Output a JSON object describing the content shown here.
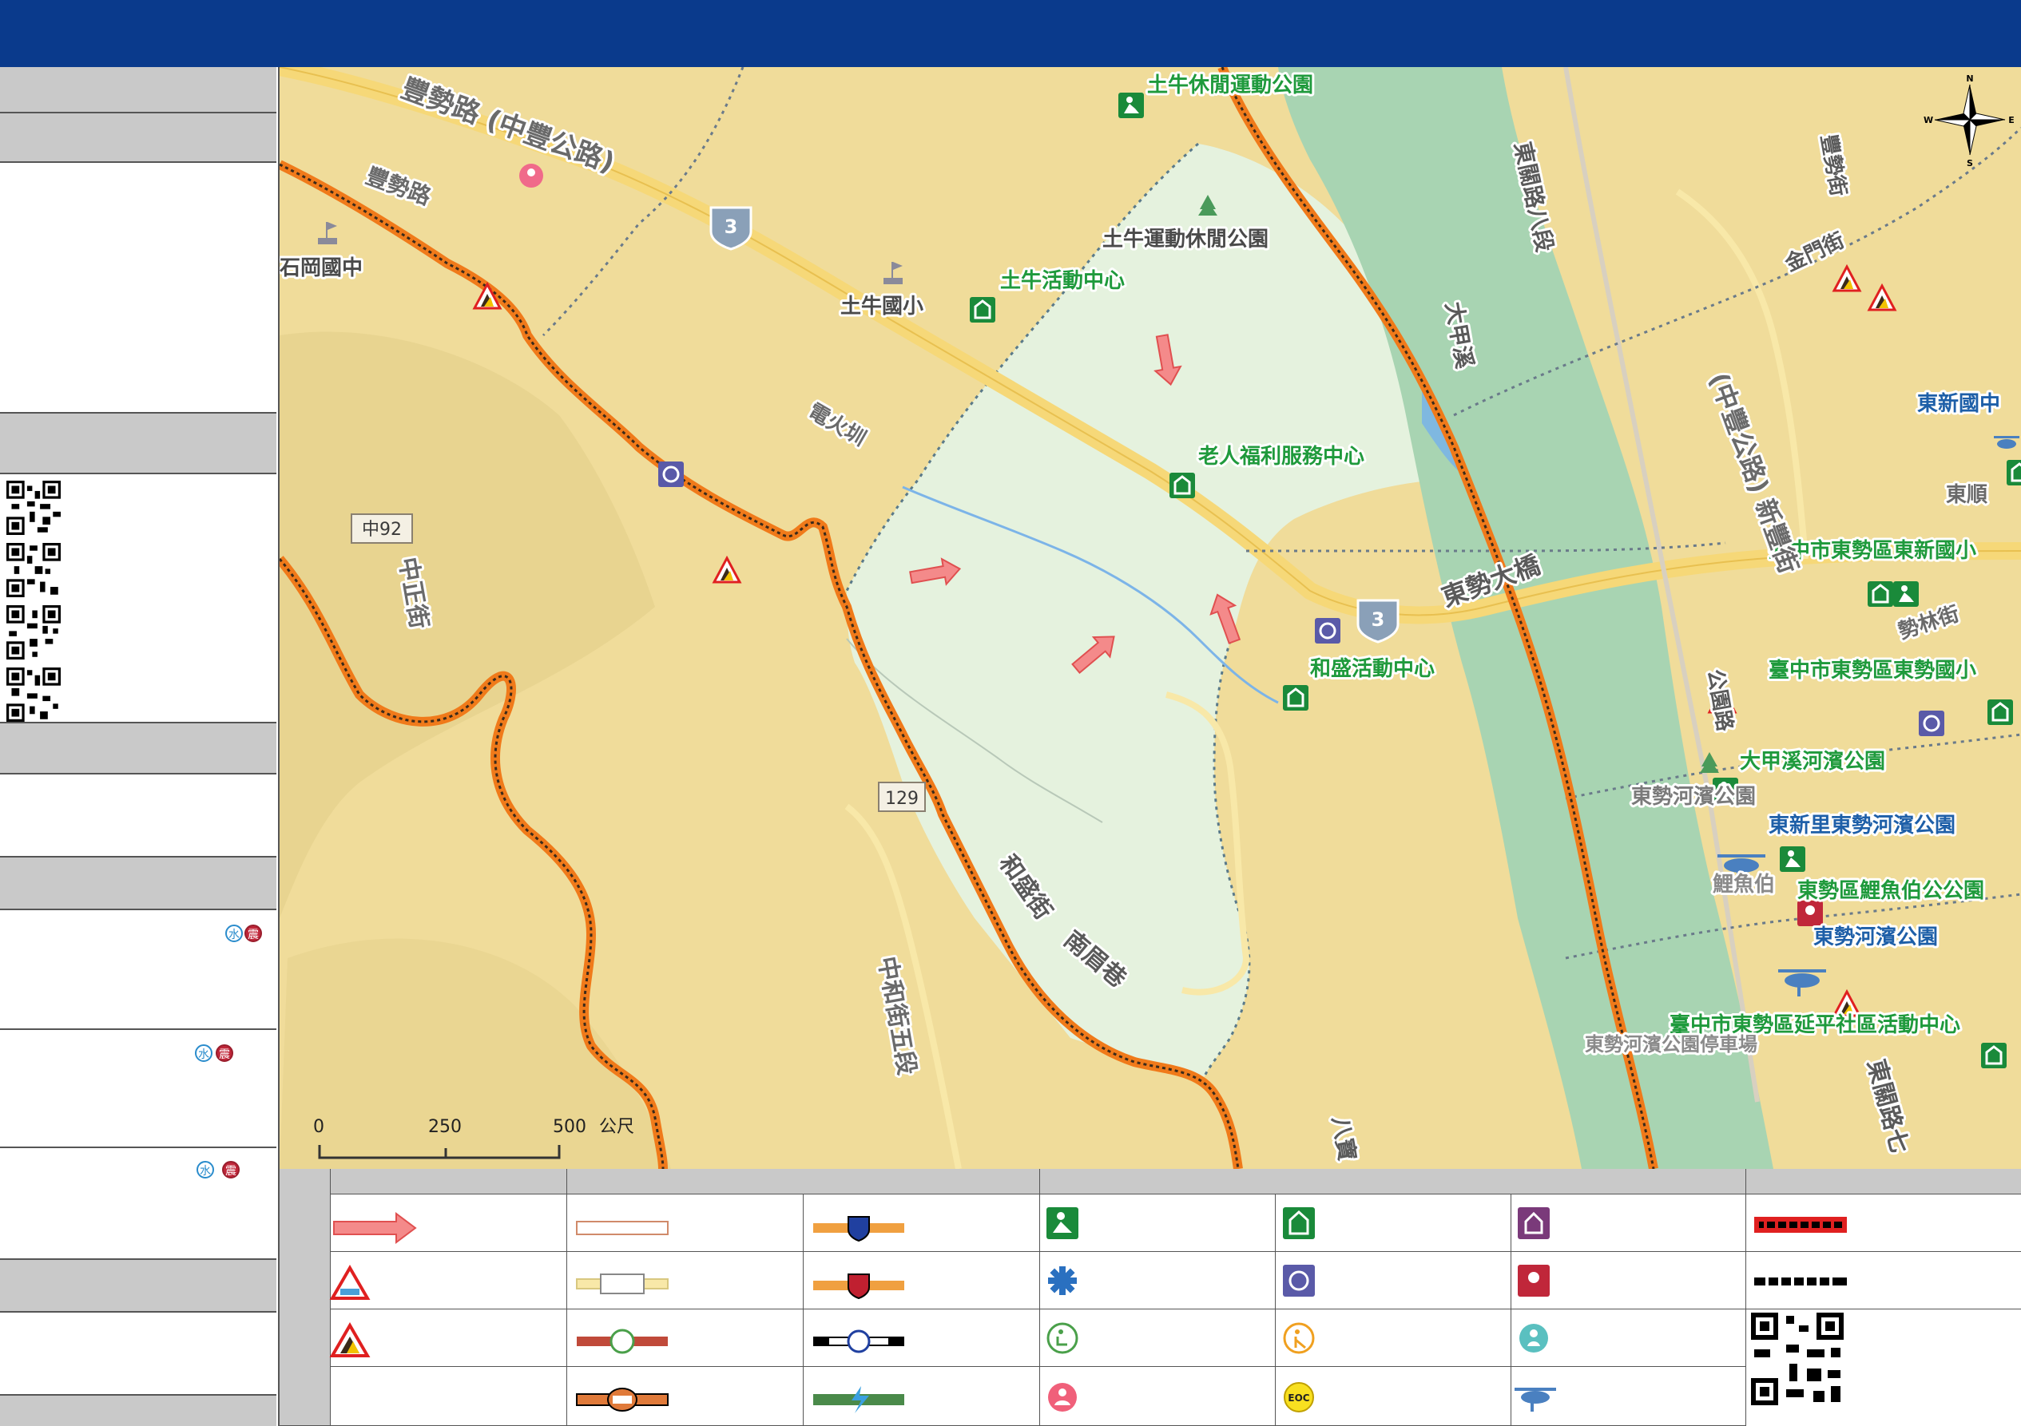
{
  "map": {
    "place_labels": {
      "tuniu_leisure_park": "土牛休閒運動公園",
      "tuniu_sports_park": "土牛運動休閒公園",
      "tuniu_activity_center": "土牛活動中心",
      "tuniu_elementary": "土牛國小",
      "shigang_junior_high": "石岡國中",
      "elderly_welfare_center": "老人福利服務中心",
      "hesheng_activity_center": "和盛活動中心",
      "dongxin_junior_high": "東新國中",
      "dongxin_elementary": "臺中市東勢區東新國小",
      "dongshi_elementary": "臺中市東勢區東勢國小",
      "dajia_riverside_park": "大甲溪河濱公園",
      "dongshi_riverside_park_gray": "東勢河濱公園",
      "dongxin_li_riverside_park": "東新里東勢河濱公園",
      "liyubo_park": "東勢區鯉魚伯公公園",
      "dongshi_riverside_park": "東勢河濱公園",
      "yanping_activity_center": "臺中市東勢區延平社區活動中心",
      "liyubo_gray": "鯉魚伯",
      "riverside_parking": "東勢河濱公園停車場"
    },
    "road_labels": {
      "fengshi_road": "豐勢路 (中豐公路)",
      "fengshi_road_short": "豐勢路",
      "dianhuo_canal": "電火圳",
      "zhongzheng_street": "中正街",
      "hesheng_street": "和盛街",
      "nanmei_lane": "南眉巷",
      "zhonghe_street": "中和街五段",
      "dajia_creek": "大甲溪",
      "dongshi_bridge": "東勢大橋",
      "dongguan_road_8": "東關路八段",
      "dongguan_road_7": "東關路七",
      "zhongfeng_xinhua": "(中豐公路) 新豐街",
      "jinmen_street": "金門街",
      "fengyuan_street": "豐勢街",
      "gongyuan_road": "公園路",
      "road_8": "八寶",
      "dongshi_road_fragment": "東順",
      "shijie_street": "勢林街"
    },
    "shields": {
      "highway_3_a": "3",
      "highway_3_b": "3",
      "county_129": "129",
      "zhong_92": "中92"
    },
    "scale_bar": {
      "tick_0": "0",
      "tick_250": "250",
      "tick_500": "500",
      "unit": "公尺"
    },
    "compass": {
      "n": "N",
      "s": "S",
      "e": "E",
      "w": "W"
    }
  },
  "sidebar": {
    "badges": {
      "water": "水",
      "quake": "震"
    }
  },
  "legend": {
    "eoc_label": "EOC"
  },
  "colors": {
    "header": "#0a3a8c",
    "map_base": "#f0dc9a",
    "flood_zone": "#e3f4e6",
    "river": "#a8d4b2",
    "evac_route": "#ff8c2a",
    "facility_green": "#1a8a3a",
    "label_green": "#1f9a3c",
    "label_blue": "#1e5fa8"
  }
}
